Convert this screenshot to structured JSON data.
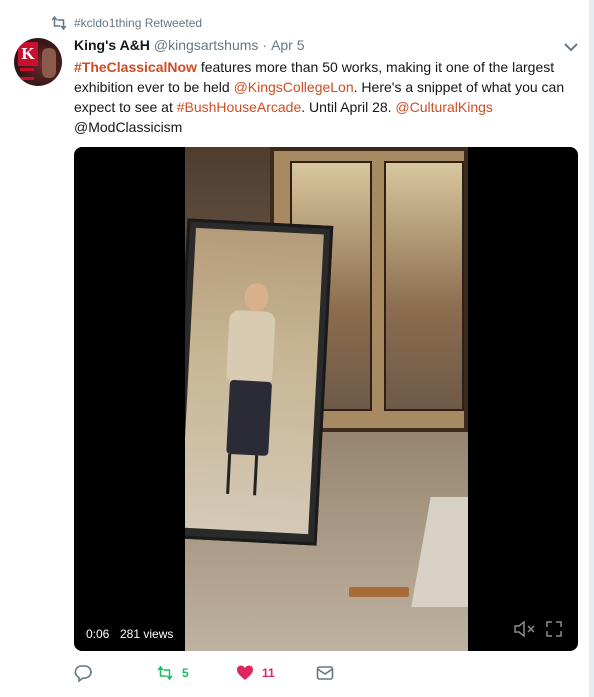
{
  "retweet_context": {
    "text": "#kcldo1thing Retweeted",
    "icon": "retweet-icon"
  },
  "tweet": {
    "author_name": "King's A&H",
    "handle": "@kingsartshums",
    "separator": "·",
    "date": "Apr 5",
    "text_parts": {
      "p1": "#TheClassicalNow",
      "p2": " features more than 50 works, making it one of the largest exhibition ever to be held ",
      "p3": "@KingsCollegeLon",
      "p4": ". Here's a snippet of what you can expect to see at ",
      "p5": "#BushHouseArcade",
      "p6": ". Until April 28. ",
      "p7": "@CulturalKings",
      "p8": " @ModClassicism"
    }
  },
  "video": {
    "time": "0:06",
    "views": "281 views"
  },
  "actions": {
    "retweet_count": "5",
    "like_count": "11"
  },
  "colors": {
    "link": "#d04d24",
    "retweet": "#17bf63",
    "like": "#e0245e",
    "muted": "#657786"
  }
}
